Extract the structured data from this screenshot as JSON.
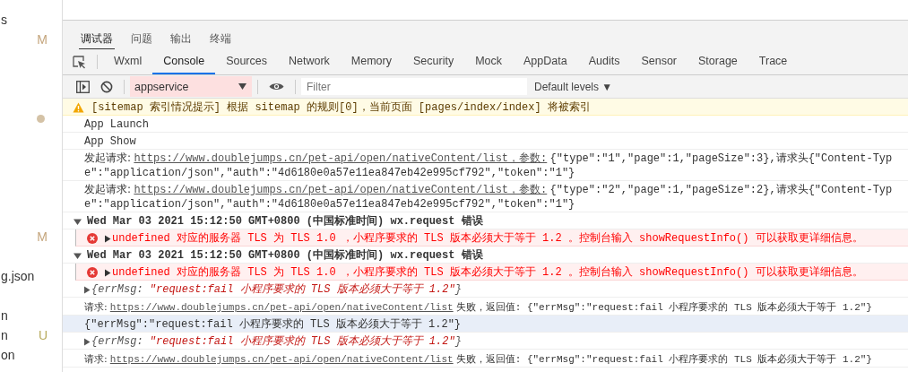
{
  "sidebar": {
    "items": [
      {
        "name": "s"
      },
      {
        "badge": "M",
        "color": "#c4a57c"
      },
      {
        "dot": true,
        "color": "#d4c2a6"
      },
      {
        "badge": "M",
        "color": "#c4a57c"
      },
      {
        "name": "g.json"
      },
      {
        "name": "n"
      },
      {
        "name": "n",
        "badge": "U",
        "color": "#b8ab5e"
      },
      {
        "name": "on"
      }
    ]
  },
  "panel_tabs": [
    {
      "label": "调试器",
      "selected": true
    },
    {
      "label": "问题",
      "selected": false
    },
    {
      "label": "输出",
      "selected": false
    },
    {
      "label": "终端",
      "selected": false
    }
  ],
  "devtools_tabs": [
    {
      "label": "Wxml",
      "selected": false
    },
    {
      "label": "Console",
      "selected": true
    },
    {
      "label": "Sources",
      "selected": false
    },
    {
      "label": "Network",
      "selected": false
    },
    {
      "label": "Memory",
      "selected": false
    },
    {
      "label": "Security",
      "selected": false
    },
    {
      "label": "Mock",
      "selected": false
    },
    {
      "label": "AppData",
      "selected": false
    },
    {
      "label": "Audits",
      "selected": false
    },
    {
      "label": "Sensor",
      "selected": false
    },
    {
      "label": "Storage",
      "selected": false
    },
    {
      "label": "Trace",
      "selected": false
    }
  ],
  "toolbar": {
    "context": "appservice",
    "filter": {
      "placeholder": "Filter"
    },
    "levels": "Default levels ▼"
  },
  "console": [
    {
      "kind": "warning",
      "selected": false,
      "text": "[sitemap 索引情况提示] 根据 sitemap 的规则[0]，当前页面 [pages/index/index] 将被索引"
    },
    {
      "kind": "log",
      "selected": false,
      "text": "App Launch"
    },
    {
      "kind": "log",
      "selected": false,
      "text": "App Show"
    },
    {
      "kind": "request",
      "selected": false,
      "prefix": "发起请求:",
      "link": "https://www.doublejumps.cn/pet-api/open/nativeContent/list，参数:",
      "text": "{\"type\":\"1\",\"page\":1,\"pageSize\":3},请求头{\"Content-Type\":\"application/json\",\"auth\":\"4d6180e0a57e11ea847eb42e995cf792\",\"token\":\"1\"}"
    },
    {
      "kind": "request",
      "selected": false,
      "prefix": "发起请求:",
      "link": "https://www.doublejumps.cn/pet-api/open/nativeContent/list，参数:",
      "text": "{\"type\":\"2\",\"page\":1,\"pageSize\":2},请求头{\"Content-Type\":\"application/json\",\"auth\":\"4d6180e0a57e11ea847eb42e995cf792\",\"token\":\"1\"}"
    },
    {
      "kind": "group",
      "selected": false,
      "expanded": true,
      "text": "Wed Mar 03 2021 15:12:50 GMT+0800 (中国标准时间) wx.request 错误"
    },
    {
      "kind": "error",
      "selected": false,
      "expanded": false,
      "text": "undefined 对应的服务器 TLS 为 TLS 1.0 ，小程序要求的 TLS 版本必须大于等于 1.2 。控制台输入 showRequestInfo() 可以获取更详细信息。"
    },
    {
      "kind": "group",
      "selected": false,
      "expanded": true,
      "text": "Wed Mar 03 2021 15:12:50 GMT+0800 (中国标准时间) wx.request 错误"
    },
    {
      "kind": "error",
      "selected": false,
      "expanded": false,
      "text": "undefined 对应的服务器 TLS 为 TLS 1.0 ，小程序要求的 TLS 版本必须大于等于 1.2 。控制台输入 showRequestInfo() 可以获取更详细信息。"
    },
    {
      "kind": "object",
      "selected": false,
      "expanded": false,
      "key": "{errMsg:",
      "value": "\"request:fail 小程序要求的 TLS 版本必须大于等于 1.2\"",
      "close": "}"
    },
    {
      "kind": "fail",
      "selected": false,
      "prefix": "请求:",
      "link": "https://www.doublejumps.cn/pet-api/open/nativeContent/list",
      "text": "失败，返回值: {\"errMsg\":\"request:fail 小程序要求的 TLS 版本必须大于等于 1.2\"}"
    },
    {
      "kind": "log",
      "selected": true,
      "text": "{\"errMsg\":\"request:fail 小程序要求的 TLS 版本必须大于等于 1.2\"}"
    },
    {
      "kind": "object",
      "selected": false,
      "expanded": false,
      "key": "{errMsg:",
      "value": "\"request:fail 小程序要求的 TLS 版本必须大于等于 1.2\"",
      "close": "}"
    },
    {
      "kind": "fail",
      "selected": false,
      "prefix": "请求:",
      "link": "https://www.doublejumps.cn/pet-api/open/nativeContent/list",
      "text": "失败，返回值: {\"errMsg\":\"request:fail 小程序要求的 TLS 版本必须大于等于 1.2\"}"
    }
  ]
}
